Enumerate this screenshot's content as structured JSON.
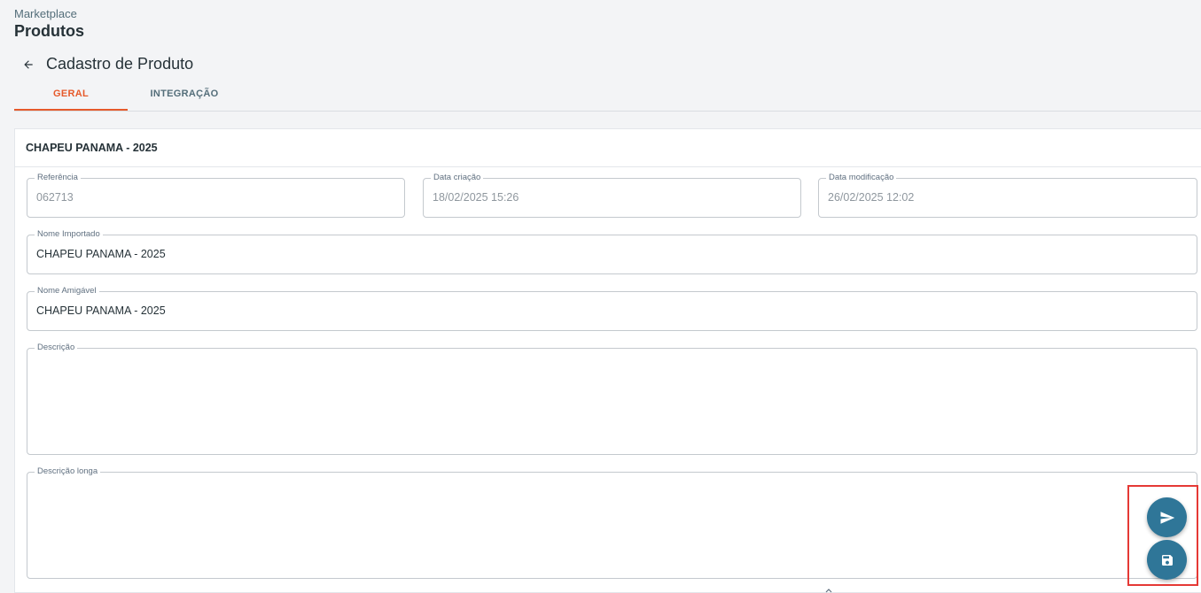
{
  "breadcrumb": "Marketplace",
  "page_title": "Produtos",
  "subheader": {
    "title": "Cadastro de Produto",
    "back_icon": "arrow-left-icon"
  },
  "tabs": [
    {
      "label": "GERAL",
      "active": true
    },
    {
      "label": "INTEGRAÇÃO",
      "active": false
    }
  ],
  "card": {
    "header": "CHAPEU PANAMA - 2025",
    "fields": {
      "referencia": {
        "label": "Referência",
        "value": "062713"
      },
      "data_criacao": {
        "label": "Data criação",
        "value": "18/02/2025 15:26"
      },
      "data_modificacao": {
        "label": "Data modificação",
        "value": "26/02/2025 12:02"
      },
      "nome_importado": {
        "label": "Nome Importado",
        "value": "CHAPEU PANAMA - 2025"
      },
      "nome_amigavel": {
        "label": "Nome Amigável",
        "value": "CHAPEU PANAMA - 2025"
      },
      "descricao": {
        "label": "Descrição",
        "value": ""
      },
      "descricao_longa": {
        "label": "Descrição longa",
        "value": ""
      }
    }
  },
  "actions": {
    "send_icon": "send-icon",
    "save_icon": "save-icon"
  },
  "colors": {
    "accent": "#e65a2b",
    "fab": "#2f7698",
    "highlight": "#e53935",
    "background": "#f3f4f6"
  }
}
